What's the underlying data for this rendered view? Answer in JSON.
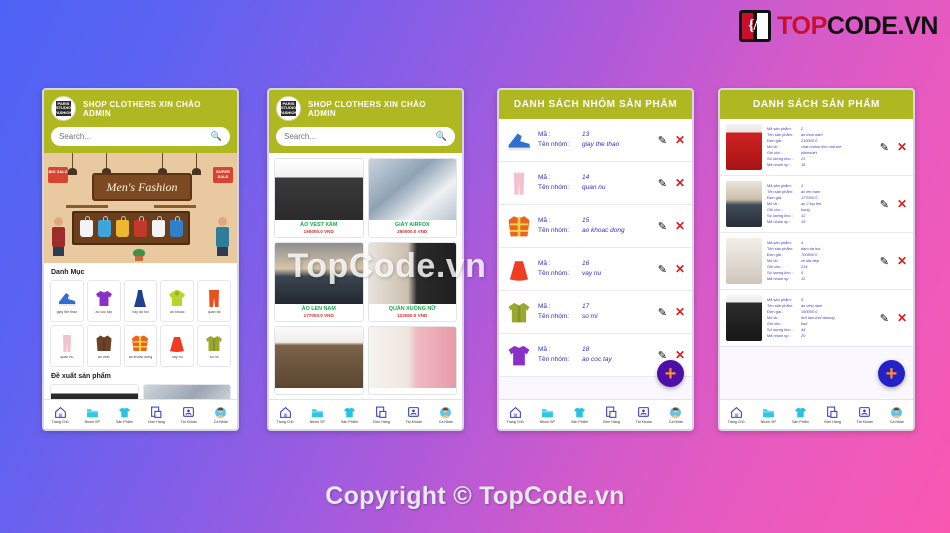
{
  "brand": {
    "prefix": "TOP",
    "suffix": "CODE.VN",
    "mark_glyph": "{/}"
  },
  "copyright": "Copyright © TopCode.vn",
  "watermark": "TopCode.vn",
  "common": {
    "app_header_title": "SHOP CLOTHERS XIN CHÀO ADMIN",
    "search_placeholder": "Search...",
    "search_icon": "search-icon",
    "logo_text": "PARIS STUDIO FASHION",
    "fab_label": "+",
    "edit_icon": "pencil-icon",
    "delete_icon": "close-x-icon",
    "nav": [
      {
        "label": "Trang Chủ",
        "icon": "home-icon"
      },
      {
        "label": "Nhóm SP",
        "icon": "folder-icon"
      },
      {
        "label": "Sản Phẩm",
        "icon": "tshirt-icon"
      },
      {
        "label": "Đơn Hàng",
        "icon": "orders-icon"
      },
      {
        "label": "Tài Khoản",
        "icon": "account-icon"
      },
      {
        "label": "Cá Nhân",
        "icon": "profile-avatar-icon"
      }
    ]
  },
  "phone1": {
    "hero": {
      "sign_text": "Men's Fashion",
      "tag_left": "BIG SALE",
      "tag_right": "SUPER SALE"
    },
    "section_category_title": "Danh Mục",
    "section_suggest_title": "Đề xuất sản phẩm",
    "categories": [
      {
        "label": "giay the thao",
        "icon": "sneaker-icon",
        "color": "#2f6fd0"
      },
      {
        "label": "ao coc tay",
        "icon": "tshirt-icon",
        "color": "#8b2fc9"
      },
      {
        "label": "vay da hoi",
        "icon": "evening-dress-icon",
        "color": "#1f3f8f"
      },
      {
        "label": "ao khoac",
        "icon": "hoodie-icon",
        "color": "#b9d42b"
      },
      {
        "label": "quan tai",
        "icon": "pants-icon",
        "color": "#e8511f"
      },
      {
        "label": "quan nu",
        "icon": "women-pants-icon",
        "color": "#f3c2cf"
      },
      {
        "label": "ao vest",
        "icon": "coat-icon",
        "color": "#6b4226"
      },
      {
        "label": "ao khoac dong",
        "icon": "winter-jacket-icon",
        "color": "#e8641f"
      },
      {
        "label": "vay nu",
        "icon": "skirt-icon",
        "color": "#f03c20"
      },
      {
        "label": "so mi",
        "icon": "shirt-icon",
        "color": "#9aa832"
      }
    ]
  },
  "phone2": {
    "products": [
      {
        "name": "ÁO VEST XÁM",
        "price": "190000.0 VND",
        "img": "gray-blazer-photo"
      },
      {
        "name": "GIÀY AIRFOX",
        "price": "250000.0 VND",
        "img": "sneakers-photo"
      },
      {
        "name": "ÁO LEN NAM",
        "price": "177000.0 VND",
        "img": "mens-sweater-photo"
      },
      {
        "name": "QUẦN XUỒNG NỮ",
        "price": "123000.0 VND",
        "img": "womens-trousers-photo"
      },
      {
        "name": "",
        "price": "",
        "img": "brown-coat-photo"
      },
      {
        "name": "",
        "price": "",
        "img": "pink-shirts-photo"
      }
    ]
  },
  "phone3": {
    "title": "DANH SÁCH NHÓM SẢN PHẨM",
    "labels": {
      "code": "Mã :",
      "name": "Tên nhóm:"
    },
    "rows": [
      {
        "code": "13",
        "name": "giay the thao",
        "icon": "sneaker-icon",
        "color": "#2f6fd0"
      },
      {
        "code": "14",
        "name": "quan nu",
        "icon": "women-pants-icon",
        "color": "#f3c2cf"
      },
      {
        "code": "15",
        "name": "ao khoac dong",
        "icon": "winter-jacket-icon",
        "color": "#e8641f"
      },
      {
        "code": "16",
        "name": "vay nu",
        "icon": "skirt-icon",
        "color": "#f03c20"
      },
      {
        "code": "17",
        "name": "so mi",
        "icon": "shirt-icon",
        "color": "#9aa832"
      },
      {
        "code": "18",
        "name": "ao coc tay",
        "icon": "tshirt-icon",
        "color": "#8b2fc9"
      }
    ]
  },
  "phone4": {
    "title": "DANH SÁCH  SẢN PHẨM",
    "labels": {
      "code": "Mã sản phẩm:",
      "name": "Tên sản phẩm:",
      "price": "Đơn giá :",
      "desc": "Mô tả :",
      "note": "Ghi chú :",
      "stock": "Số lượng kho :",
      "group": "Mã nhóm sp :"
    },
    "rows": [
      {
        "code": "2",
        "name": "ao thun nam",
        "price": "210000.0",
        "desc": "chat cotton kho mat me",
        "note": "tshirtshirt",
        "stock": "23",
        "group": "18",
        "img": "red-tshirt-photo"
      },
      {
        "code": "3",
        "name": "ao len nam",
        "price": "177000.0",
        "desc": "ao 2 lop len",
        "note": "hung",
        "stock": "12",
        "group": "19",
        "img": "sweater-photo"
      },
      {
        "code": "4",
        "name": "dam da hoi",
        "price": "700500.0",
        "desc": "ve dai dep",
        "note": "234",
        "stock": "5",
        "group": "12",
        "img": "evening-dress-photo"
      },
      {
        "code": "5",
        "name": "ao vest nam",
        "price": "190000.0",
        "desc": "lich lam thoi tbuong",
        "note": "fsuf",
        "stock": "44",
        "group": "20",
        "img": "black-suit-photo"
      }
    ]
  }
}
